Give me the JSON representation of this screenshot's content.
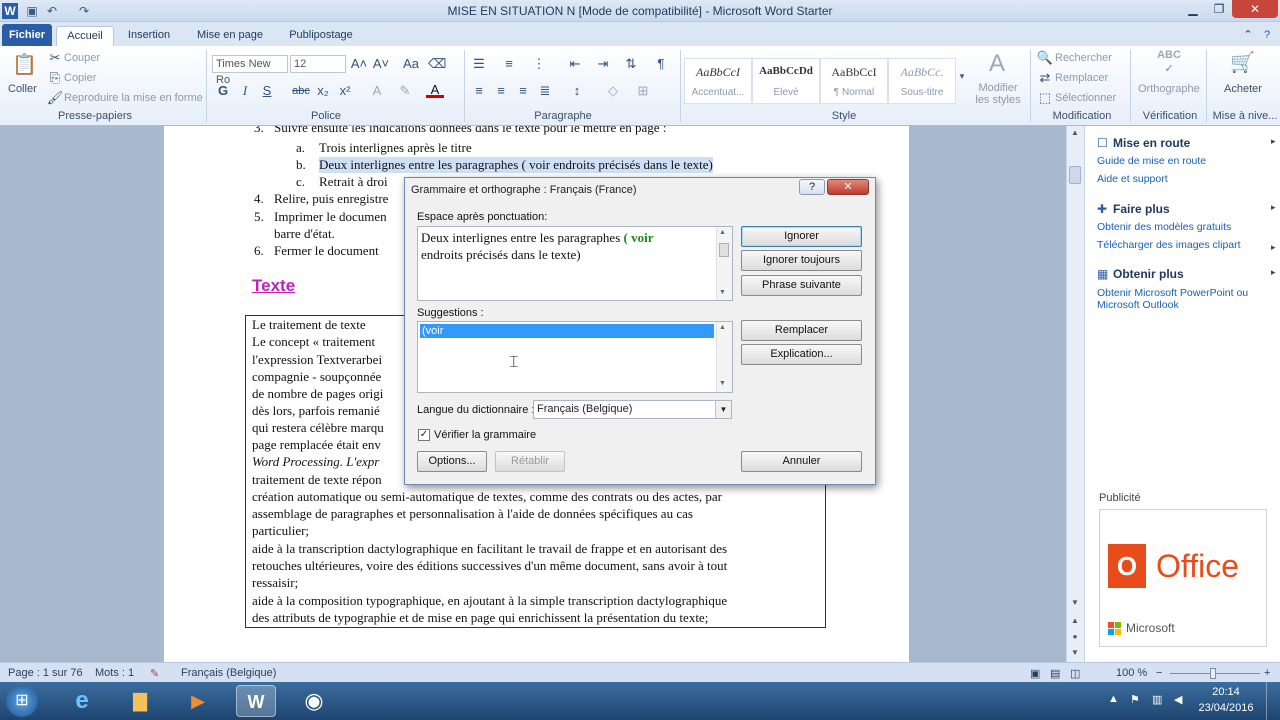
{
  "window": {
    "title": "MISE EN SITUATION N [Mode de compatibilité] - Microsoft Word Starter"
  },
  "tabs": [
    "Fichier",
    "Accueil",
    "Insertion",
    "Mise en page",
    "Publipostage"
  ],
  "ribbon": {
    "clipboard": {
      "paste": "Coller",
      "cut": "Couper",
      "copy": "Copier",
      "format_painter": "Reproduire la mise en forme",
      "group": "Presse-papiers"
    },
    "font": {
      "name": "Times New Ro",
      "size": "12",
      "group": "Police",
      "bold": "G",
      "italic": "I",
      "underline": "S",
      "strike": "abc",
      "sub": "x₂",
      "sup": "x²"
    },
    "paragraph": {
      "group": "Paragraphe"
    },
    "styles": {
      "items": [
        {
          "sample": "AaBbCcI",
          "name": "Accentuat..."
        },
        {
          "sample": "AaBbCcDd",
          "name": "Elevé"
        },
        {
          "sample": "AaBbCcI",
          "name": "¶ Normal"
        },
        {
          "sample": "AaBbCc.",
          "name": "Sous-titre"
        }
      ],
      "modify": "Modifier les styles",
      "group": "Style"
    },
    "editing": {
      "find": "Rechercher",
      "replace": "Remplacer",
      "select": "Sélectionner",
      "group": "Modification"
    },
    "proofing": {
      "label": "Orthographe",
      "group": "Vérification"
    },
    "buy": {
      "label": "Acheter",
      "group": "Mise à nive..."
    }
  },
  "document": {
    "lines": [
      "Suivre ensuite les indications données dans le texte pour le mettre en page :",
      "Trois interlignes après le titre",
      "Deux interlignes entre les paragraphes ( voir endroits précisés dans le texte)",
      "Retrait à droi",
      "Relire, puis enregistre",
      "Imprimer le documen",
      "barre d'état.",
      "Fermer le document"
    ],
    "markers": [
      "a.",
      "b.",
      "c.",
      "4.",
      "5.",
      "6."
    ],
    "heading": "Texte",
    "box_lines": [
      "Le traitement de texte",
      "Le concept « traitement",
      "l'expression Textverarbei",
      "compagnie - soupçonnée",
      "de nombre de pages origi",
      "dès lors, parfois remanié",
      "qui restera célèbre marqu",
      "page remplacée était env",
      "Word Processing. L'expr",
      "traitement de texte répon",
      "création automatique ou semi-automatique de textes, comme des contrats ou des actes, par",
      "assemblage de paragraphes et personnalisation à l'aide de données spécifiques au cas",
      "particulier;",
      "aide à la transcription dactylographique en facilitant le travail de frappe et en autorisant des",
      "retouches ultérieures, voire des éditions successives d'un même document, sans avoir à tout",
      "ressaisir;",
      "aide à la composition typographique, en ajoutant à la simple transcription dactylographique",
      "des attributs de typographie et de mise en page qui enrichissent la présentation du texte;"
    ]
  },
  "dialog": {
    "title": "Grammaire et orthographe : Français (France)",
    "error_label": "Espace après ponctuation:",
    "error_text_1": "Deux interlignes entre les paragraphes",
    "error_word": "( voir",
    "error_text_2": "endroits précisés dans le texte)",
    "suggestions_label": "Suggestions :",
    "suggestion": "(voir",
    "dict_label": "Langue du dictionnaire :",
    "dict_value": "Français (Belgique)",
    "check_grammar": "Vérifier la grammaire",
    "buttons": {
      "ignore": "Ignorer",
      "ignore_all": "Ignorer toujours",
      "next": "Phrase suivante",
      "replace": "Remplacer",
      "explain": "Explication...",
      "options": "Options...",
      "undo": "Rétablir",
      "cancel": "Annuler"
    }
  },
  "pane": {
    "get_started": {
      "title": "Mise en route",
      "links": [
        "Guide de mise en route",
        "Aide et support"
      ]
    },
    "do_more": {
      "title": "Faire plus",
      "links": [
        "Obtenir des modèles gratuits",
        "Télécharger des images clipart"
      ]
    },
    "get_more": {
      "title": "Obtenir plus",
      "links": [
        "Obtenir Microsoft PowerPoint ou",
        "Microsoft Outlook"
      ]
    },
    "ad_label": "Publicité",
    "ad_brand": "Office",
    "ad_company": "Microsoft"
  },
  "status": {
    "page": "Page : 1 sur 76",
    "words": "Mots : 1",
    "language": "Français (Belgique)",
    "zoom": "100 %"
  },
  "taskbar": {
    "time": "20:14",
    "date": "23/04/2016"
  }
}
